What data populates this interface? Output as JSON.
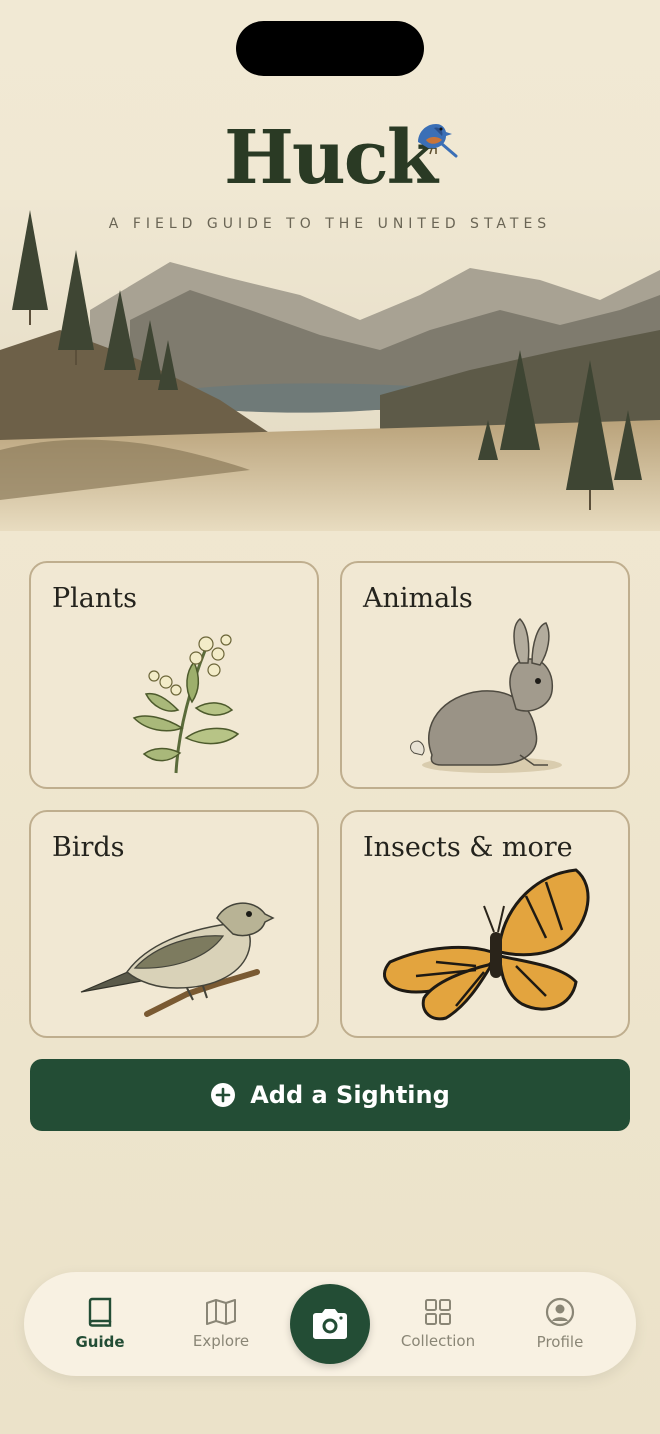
{
  "app": {
    "title": "Huck",
    "tagline": "A FIELD GUIDE TO THE UNITED STATES"
  },
  "categories": [
    {
      "label": "Plants",
      "icon": "plant-illustration"
    },
    {
      "label": "Animals",
      "icon": "rabbit-illustration"
    },
    {
      "label": "Birds",
      "icon": "bird-illustration"
    },
    {
      "label": "Insects & more",
      "icon": "butterfly-illustration"
    }
  ],
  "cta": {
    "label": "Add a Sighting",
    "icon": "plus-circle-icon"
  },
  "tabs": [
    {
      "label": "Guide",
      "icon": "book-icon",
      "active": true
    },
    {
      "label": "Explore",
      "icon": "map-icon",
      "active": false
    },
    {
      "label": "",
      "icon": "camera-icon",
      "active": false
    },
    {
      "label": "Collection",
      "icon": "grid-icon",
      "active": false
    },
    {
      "label": "Profile",
      "icon": "person-circle-icon",
      "active": false
    }
  ],
  "colors": {
    "primary": "#234d35",
    "background": "#efe6cf",
    "card_border": "#bfae8e",
    "text": "#24231d",
    "inactive_tab": "#8a8676"
  }
}
